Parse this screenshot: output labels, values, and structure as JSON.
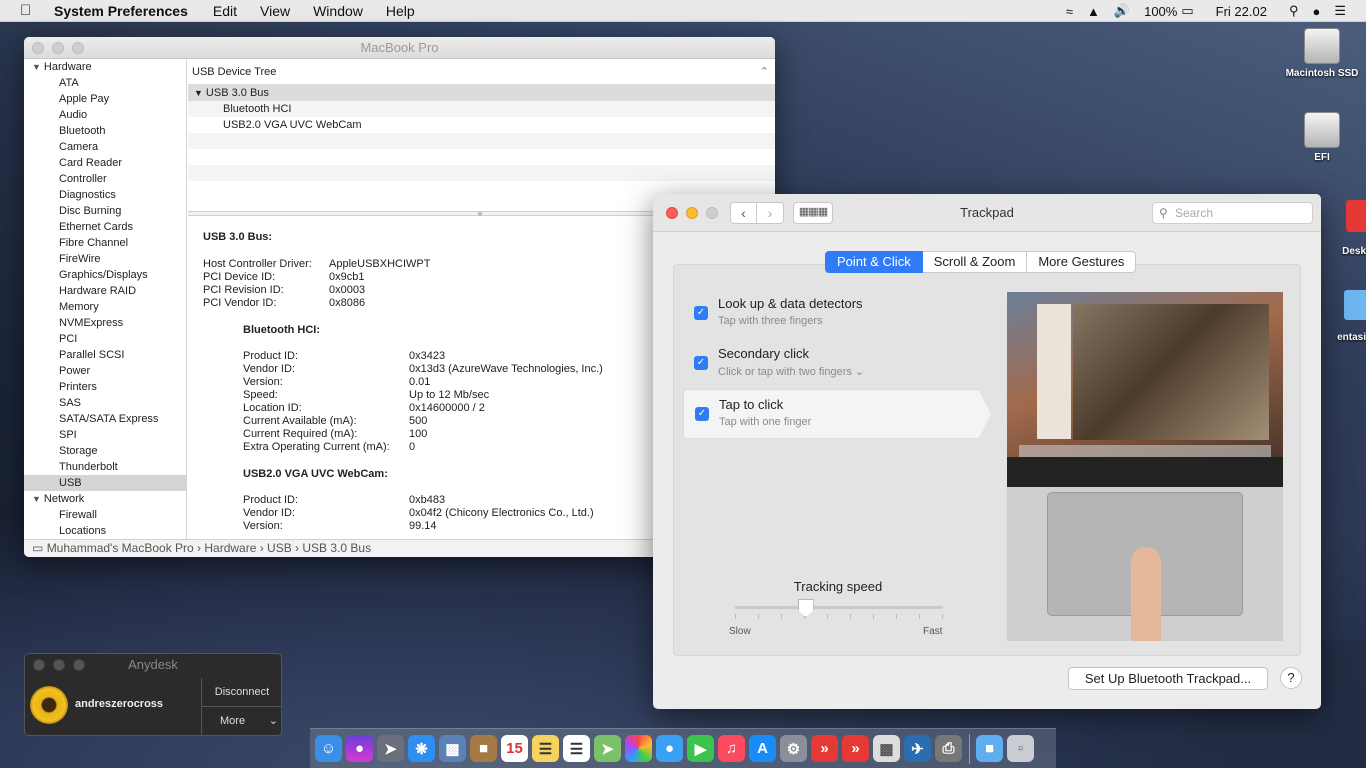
{
  "menubar": {
    "apple_icon": "apple-icon",
    "app": "System Preferences",
    "items": [
      "Edit",
      "View",
      "Window",
      "Help"
    ],
    "right": {
      "battery": "100%",
      "clock": "Fri 22.02"
    }
  },
  "sysinfo": {
    "title": "MacBook Pro",
    "sidebar": {
      "groups": [
        {
          "label": "Hardware",
          "items": [
            "ATA",
            "Apple Pay",
            "Audio",
            "Bluetooth",
            "Camera",
            "Card Reader",
            "Controller",
            "Diagnostics",
            "Disc Burning",
            "Ethernet Cards",
            "Fibre Channel",
            "FireWire",
            "Graphics/Displays",
            "Hardware RAID",
            "Memory",
            "NVMExpress",
            "PCI",
            "Parallel SCSI",
            "Power",
            "Printers",
            "SAS",
            "SATA/SATA Express",
            "SPI",
            "Storage",
            "Thunderbolt",
            "USB"
          ]
        },
        {
          "label": "Network",
          "items": [
            "Firewall",
            "Locations"
          ]
        }
      ],
      "selected": "USB"
    },
    "tree": {
      "header": "USB Device Tree",
      "root": "USB 3.0 Bus",
      "children": [
        "Bluetooth HCI",
        "USB2.0 VGA UVC WebCam"
      ]
    },
    "detail": {
      "heading": "USB 3.0 Bus:",
      "bus": [
        [
          "Host Controller Driver:",
          "AppleUSBXHCIWPT"
        ],
        [
          "PCI Device ID:",
          "0x9cb1"
        ],
        [
          "PCI Revision ID:",
          "0x0003"
        ],
        [
          "PCI Vendor ID:",
          "0x8086"
        ]
      ],
      "bt_heading": "Bluetooth HCI:",
      "bt": [
        [
          "Product ID:",
          "0x3423"
        ],
        [
          "Vendor ID:",
          "0x13d3  (AzureWave Technologies, Inc.)"
        ],
        [
          "Version:",
          "0.01"
        ],
        [
          "Speed:",
          "Up to 12 Mb/sec"
        ],
        [
          "Location ID:",
          "0x14600000 / 2"
        ],
        [
          "Current Available (mA):",
          "500"
        ],
        [
          "Current Required (mA):",
          "100"
        ],
        [
          "Extra Operating Current (mA):",
          "0"
        ]
      ],
      "cam_heading": "USB2.0 VGA UVC WebCam:",
      "cam": [
        [
          "Product ID:",
          "0xb483"
        ],
        [
          "Vendor ID:",
          "0x04f2  (Chicony Electronics Co., Ltd.)"
        ],
        [
          "Version:",
          "99.14"
        ]
      ]
    },
    "status": "Muhammad's MacBook Pro › Hardware › USB › USB 3.0 Bus"
  },
  "trackpad": {
    "title": "Trackpad",
    "search_placeholder": "Search",
    "tabs": [
      "Point & Click",
      "Scroll & Zoom",
      "More Gestures"
    ],
    "options": [
      {
        "title": "Look up & data detectors",
        "sub": "Tap with three fingers"
      },
      {
        "title": "Secondary click",
        "sub": "Click or tap with two fingers ⌄"
      },
      {
        "title": "Tap to click",
        "sub": "Tap with one finger"
      }
    ],
    "tracking": {
      "label": "Tracking speed",
      "slow": "Slow",
      "fast": "Fast",
      "value_fraction": 0.34
    },
    "bt_button": "Set Up Bluetooth Trackpad...",
    "help": "?"
  },
  "anydesk": {
    "title": "Anydesk",
    "user": "andreszerocross",
    "disconnect": "Disconnect",
    "more": "More"
  },
  "desktop": {
    "icons": [
      "Macintosh SSD",
      "EFI",
      "Desk",
      "entasi"
    ]
  }
}
